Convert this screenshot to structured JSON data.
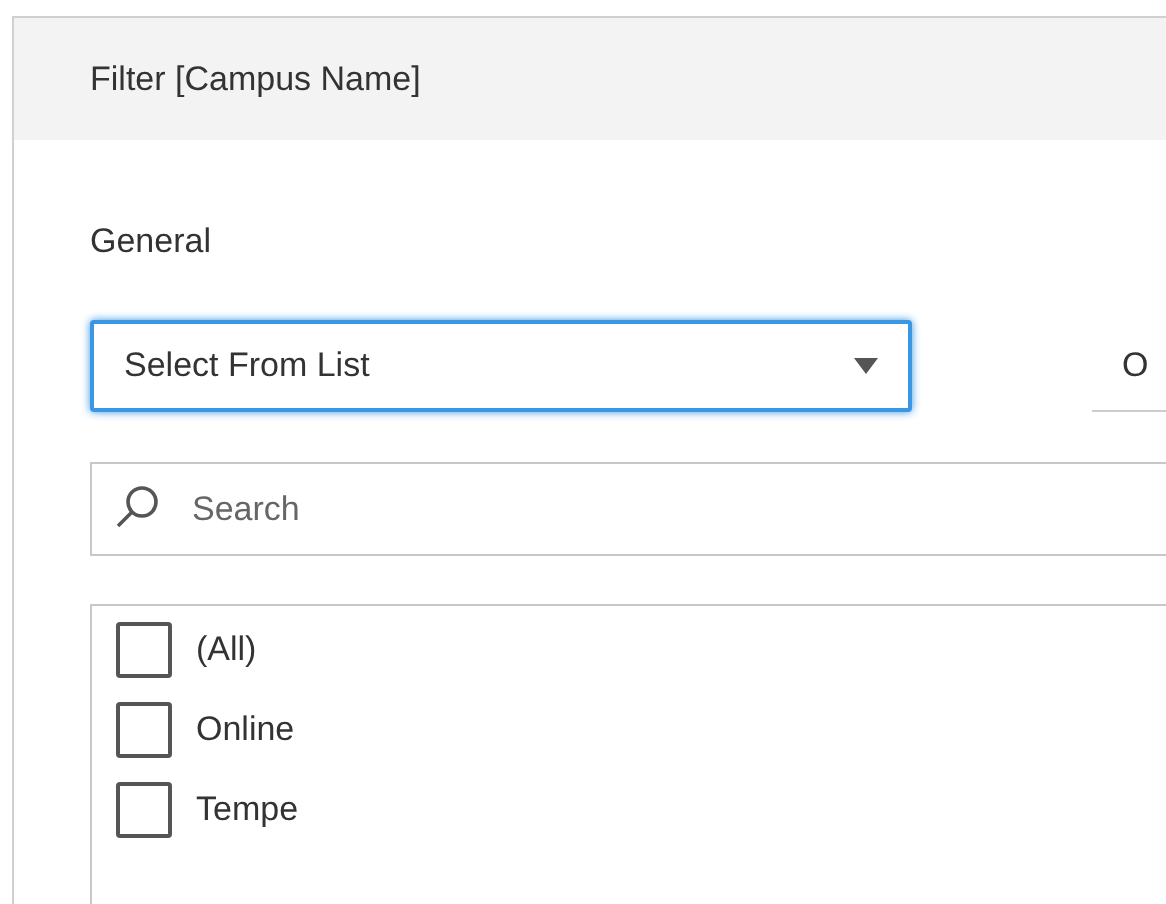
{
  "dialog": {
    "title": "Filter [Campus Name]"
  },
  "section_label": "General",
  "mode_dropdown": {
    "value": "Select From List"
  },
  "side_field": {
    "value": "O"
  },
  "search": {
    "placeholder": "Search"
  },
  "values": [
    {
      "label": "(All)",
      "checked": false
    },
    {
      "label": "Online",
      "checked": false
    },
    {
      "label": "Tempe",
      "checked": false
    }
  ]
}
